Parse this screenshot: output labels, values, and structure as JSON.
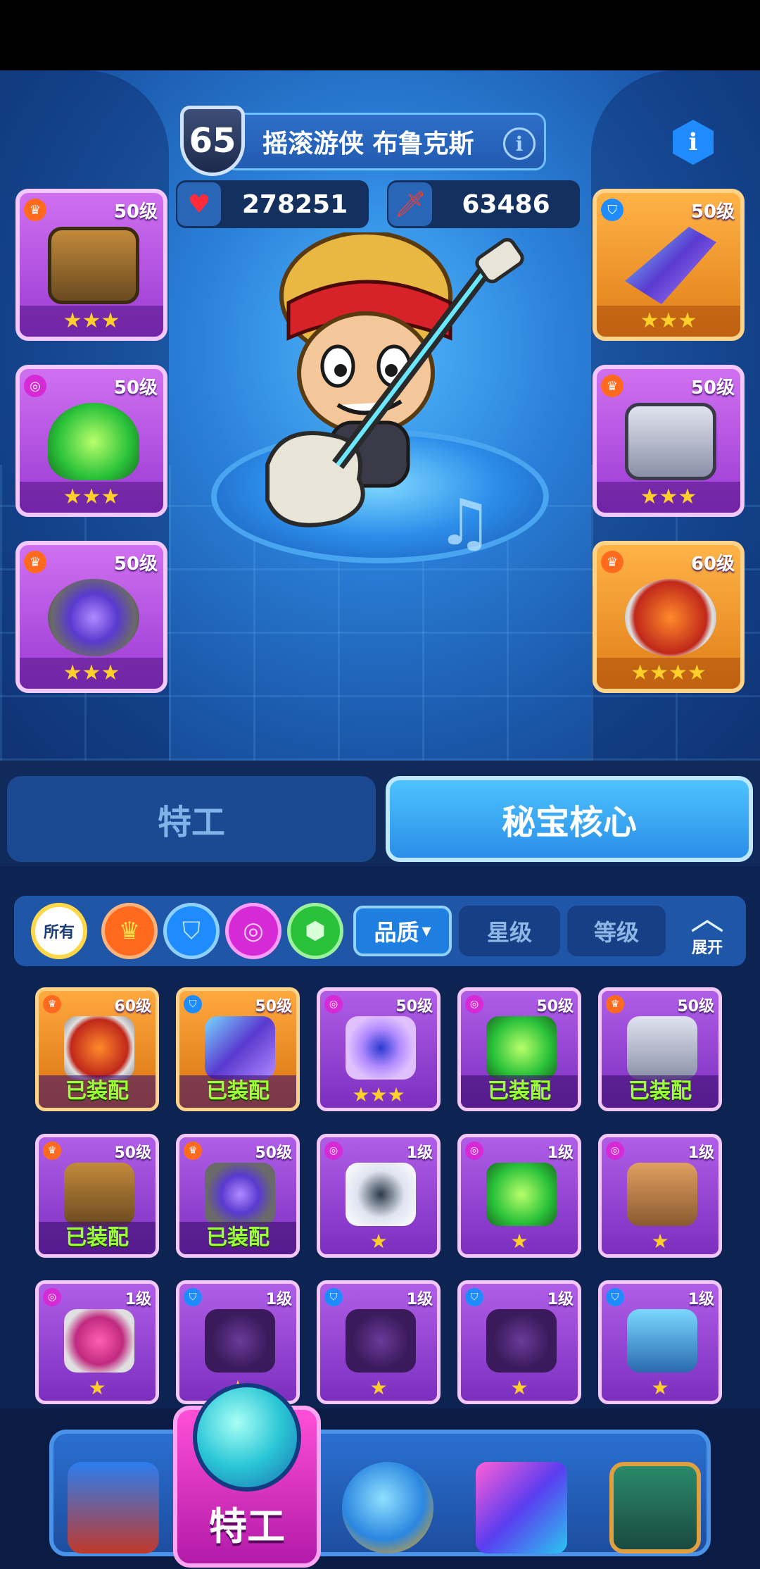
{
  "hero": {
    "level": "65",
    "name": "摇滚游侠 布鲁克斯",
    "info_icon": "info-icon",
    "hp": "278251",
    "attack": "63486"
  },
  "equipped_slots": {
    "left": [
      {
        "level": "50级",
        "stars": "★★★",
        "art": "tome"
      },
      {
        "level": "50级",
        "stars": "★★★",
        "art": "green-flame"
      },
      {
        "level": "50级",
        "stars": "★★★",
        "art": "stone-orb"
      }
    ],
    "right": [
      {
        "level": "50级",
        "stars": "★★★",
        "art": "crystal-shard"
      },
      {
        "level": "50级",
        "stars": "★★★",
        "art": "mech-gauntlet"
      },
      {
        "level": "60级",
        "stars": "★★★★",
        "art": "scroll-ring"
      }
    ]
  },
  "tabs": {
    "agent": "特工",
    "core": "秘宝核心"
  },
  "filters": {
    "all": "所有",
    "quality": "品质",
    "quality_arrow": "▾",
    "star": "星级",
    "level": "等级",
    "expand": "展开"
  },
  "inventory": [
    {
      "level": "60级",
      "status": "已装配",
      "stars": "",
      "rarity": "orange",
      "tag": "fire"
    },
    {
      "level": "50级",
      "status": "已装配",
      "stars": "",
      "rarity": "orange",
      "tag": "shield"
    },
    {
      "level": "50级",
      "status": "",
      "stars": "★★★",
      "rarity": "purple",
      "tag": "ring"
    },
    {
      "level": "50级",
      "status": "已装配",
      "stars": "",
      "rarity": "purple",
      "tag": "ring"
    },
    {
      "level": "50级",
      "status": "已装配",
      "stars": "",
      "rarity": "purple",
      "tag": "fire"
    },
    {
      "level": "50级",
      "status": "已装配",
      "stars": "",
      "rarity": "purple",
      "tag": "fire"
    },
    {
      "level": "50级",
      "status": "已装配",
      "stars": "",
      "rarity": "purple",
      "tag": "fire"
    },
    {
      "level": "1级",
      "status": "",
      "stars": "★",
      "rarity": "purple",
      "tag": "ring"
    },
    {
      "level": "1级",
      "status": "",
      "stars": "★",
      "rarity": "purple",
      "tag": "ring"
    },
    {
      "level": "1级",
      "status": "",
      "stars": "★",
      "rarity": "purple",
      "tag": "ring"
    },
    {
      "level": "1级",
      "status": "",
      "stars": "★",
      "rarity": "purple",
      "tag": "ring"
    },
    {
      "level": "1级",
      "status": "",
      "stars": "★",
      "rarity": "purple",
      "tag": "shield"
    },
    {
      "level": "1级",
      "status": "",
      "stars": "★",
      "rarity": "purple",
      "tag": "shield"
    },
    {
      "level": "1级",
      "status": "",
      "stars": "★",
      "rarity": "purple",
      "tag": "shield"
    },
    {
      "level": "1级",
      "status": "",
      "stars": "★",
      "rarity": "purple",
      "tag": "shield"
    }
  ],
  "nav": {
    "agent_label": "特工"
  },
  "colors": {
    "accent_blue": "#2a8ee8",
    "rarity_purple": "#9a3ad4",
    "rarity_orange": "#e07d17",
    "equipped_green": "#9cff3a",
    "star_gold": "#ffcf2a"
  }
}
